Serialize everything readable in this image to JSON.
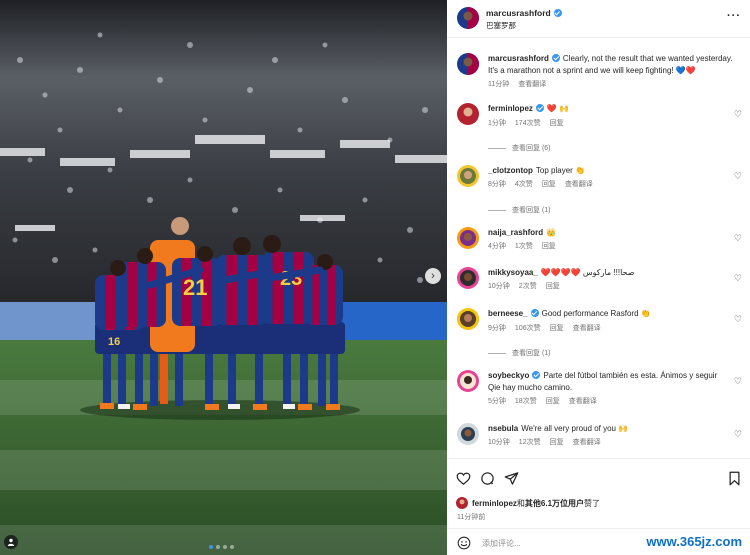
{
  "post": {
    "author": "marcusrashford",
    "location": "巴塞罗那",
    "more_icon": "more-icon",
    "caption": "Clearly, not the result that we wanted yesterday. It's a marathon not a sprint and we will keep fighting! 💙❤️",
    "caption_time": "11分钟",
    "caption_translate": "查看翻译"
  },
  "comments": [
    {
      "user": "ferminlopez",
      "verified": true,
      "text": "❤️ 🙌",
      "time": "1分钟",
      "likes": "174次赞",
      "reply": "回复",
      "translate": ""
    },
    {
      "user": "_clotzontop",
      "verified": false,
      "text": "Top player 👏",
      "time": "8分钟",
      "likes": "4次赞",
      "reply": "回复",
      "translate": "查看翻译"
    },
    {
      "user": "naija_rashford",
      "verified": false,
      "text": "👑",
      "time": "4分钟",
      "likes": "1次赞",
      "reply": "回复",
      "translate": ""
    },
    {
      "user": "mikkysoyaa_",
      "verified": false,
      "text": "❤️❤️❤️❤️ صحا!!! ماركوس",
      "time": "10分钟",
      "likes": "2次赞",
      "reply": "回复",
      "translate": ""
    },
    {
      "user": "berneese_",
      "verified": true,
      "text": "Good performance Rasford 👏",
      "time": "9分钟",
      "likes": "106次赞",
      "reply": "回复",
      "translate": "查看翻译"
    },
    {
      "user": "soybeckyo",
      "verified": true,
      "text": "Parte del fútbol también es esta. Ánimos y seguir Qie hay mucho camino.",
      "time": "5分钟",
      "likes": "18次赞",
      "reply": "回复",
      "translate": "查看翻译"
    },
    {
      "user": "nsebula",
      "verified": false,
      "text": "We're all very proud of you 🙌",
      "time": "10分钟",
      "likes": "12次赞",
      "reply": "回复",
      "translate": "查看翻译"
    }
  ],
  "view_replies": [
    "查看回复 (6)",
    "查看回复 (1)",
    "查看回复 (1)"
  ],
  "actions": {
    "liked_by_user": "ferminlopez",
    "liked_by_rest": "和",
    "liked_by_others": "其他6.1万位用户",
    "liked_by_suffix": "赞了",
    "post_time": "11分钟前",
    "add_comment_placeholder": "添加评论..."
  },
  "watermark": "www.365jz.com",
  "colors": {
    "accent": "#3897f0",
    "barca_blue": "#1d3a8a",
    "barca_red": "#a50044",
    "pitch": "#3e6b34"
  }
}
